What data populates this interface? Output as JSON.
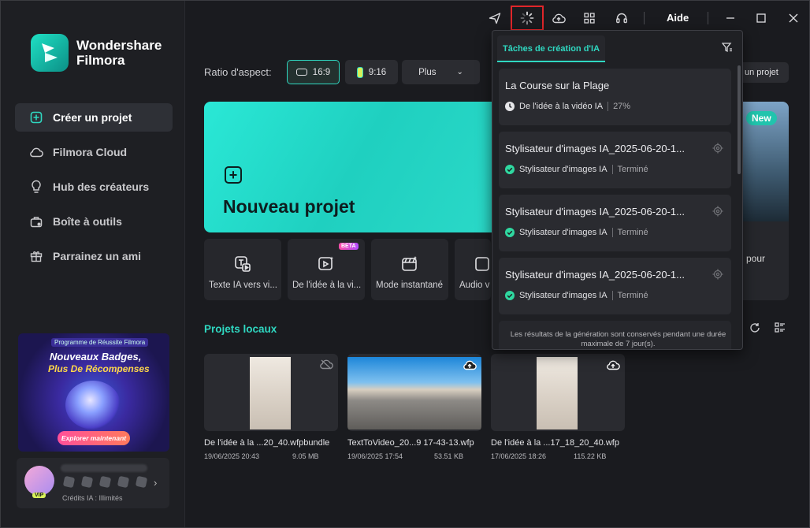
{
  "app": {
    "brand_line1": "Wondershare",
    "brand_line2": "Filmora"
  },
  "sidebar": {
    "items": [
      {
        "label": "Créer un projet"
      },
      {
        "label": "Filmora Cloud"
      },
      {
        "label": "Hub des créateurs"
      },
      {
        "label": "Boîte à outils"
      },
      {
        "label": "Parrainez un ami"
      }
    ],
    "promo": {
      "tag": "Programme de Réussite Filmora",
      "line1": "Nouveaux Badges,",
      "line2": "Plus De Récompenses",
      "cta": "Explorer maintenant"
    },
    "user": {
      "vip": "VIP",
      "credits": "Crédits IA : Illimités"
    }
  },
  "titlebar": {
    "help": "Aide"
  },
  "aspect": {
    "label": "Ratio d'aspect:",
    "r1": "16:9",
    "r2": "9:16",
    "more": "Plus",
    "open_project": "un projet"
  },
  "hero": {
    "title": "Nouveau projet"
  },
  "quick_actions": [
    {
      "label": "Texte IA vers vi..."
    },
    {
      "label": "De l'idée à la vi...",
      "badge": "BETA"
    },
    {
      "label": "Mode instantané"
    },
    {
      "label": "Audio v"
    }
  ],
  "right_card": {
    "badge": "New",
    "text": "pour"
  },
  "local": {
    "title": "Projets locaux",
    "files": [
      {
        "name": "De l'idée à la ...20_40.wfpbundle",
        "date": "19/06/2025 20:43",
        "size": "9.05 MB"
      },
      {
        "name": "TextToVideo_20...9 17-43-13.wfp",
        "date": "19/06/2025 17:54",
        "size": "53.51 KB"
      },
      {
        "name": "De l'idée à la ...17_18_20_40.wfp",
        "date": "17/06/2025 18:26",
        "size": "115.22 KB"
      }
    ]
  },
  "ai_panel": {
    "tab": "Tâches de création d'IA",
    "tasks": [
      {
        "title": "La Course sur la Plage",
        "type": "De l'idée à la vidéo IA",
        "status": "27%",
        "state": "running"
      },
      {
        "title": "Stylisateur d'images IA_2025-06-20-1...",
        "type": "Stylisateur d'images IA",
        "status": "Terminé",
        "state": "done"
      },
      {
        "title": "Stylisateur d'images IA_2025-06-20-1...",
        "type": "Stylisateur d'images IA",
        "status": "Terminé",
        "state": "done"
      },
      {
        "title": "Stylisateur d'images IA_2025-06-20-1...",
        "type": "Stylisateur d'images IA",
        "status": "Terminé",
        "state": "done"
      }
    ],
    "note_line1": "Les résultats de la génération sont conservés pendant une durée",
    "note_line2": "maximale de 7 jour(s).",
    "colors": {
      "accent": "#2fd8c1",
      "done": "#2fd8a0"
    }
  }
}
